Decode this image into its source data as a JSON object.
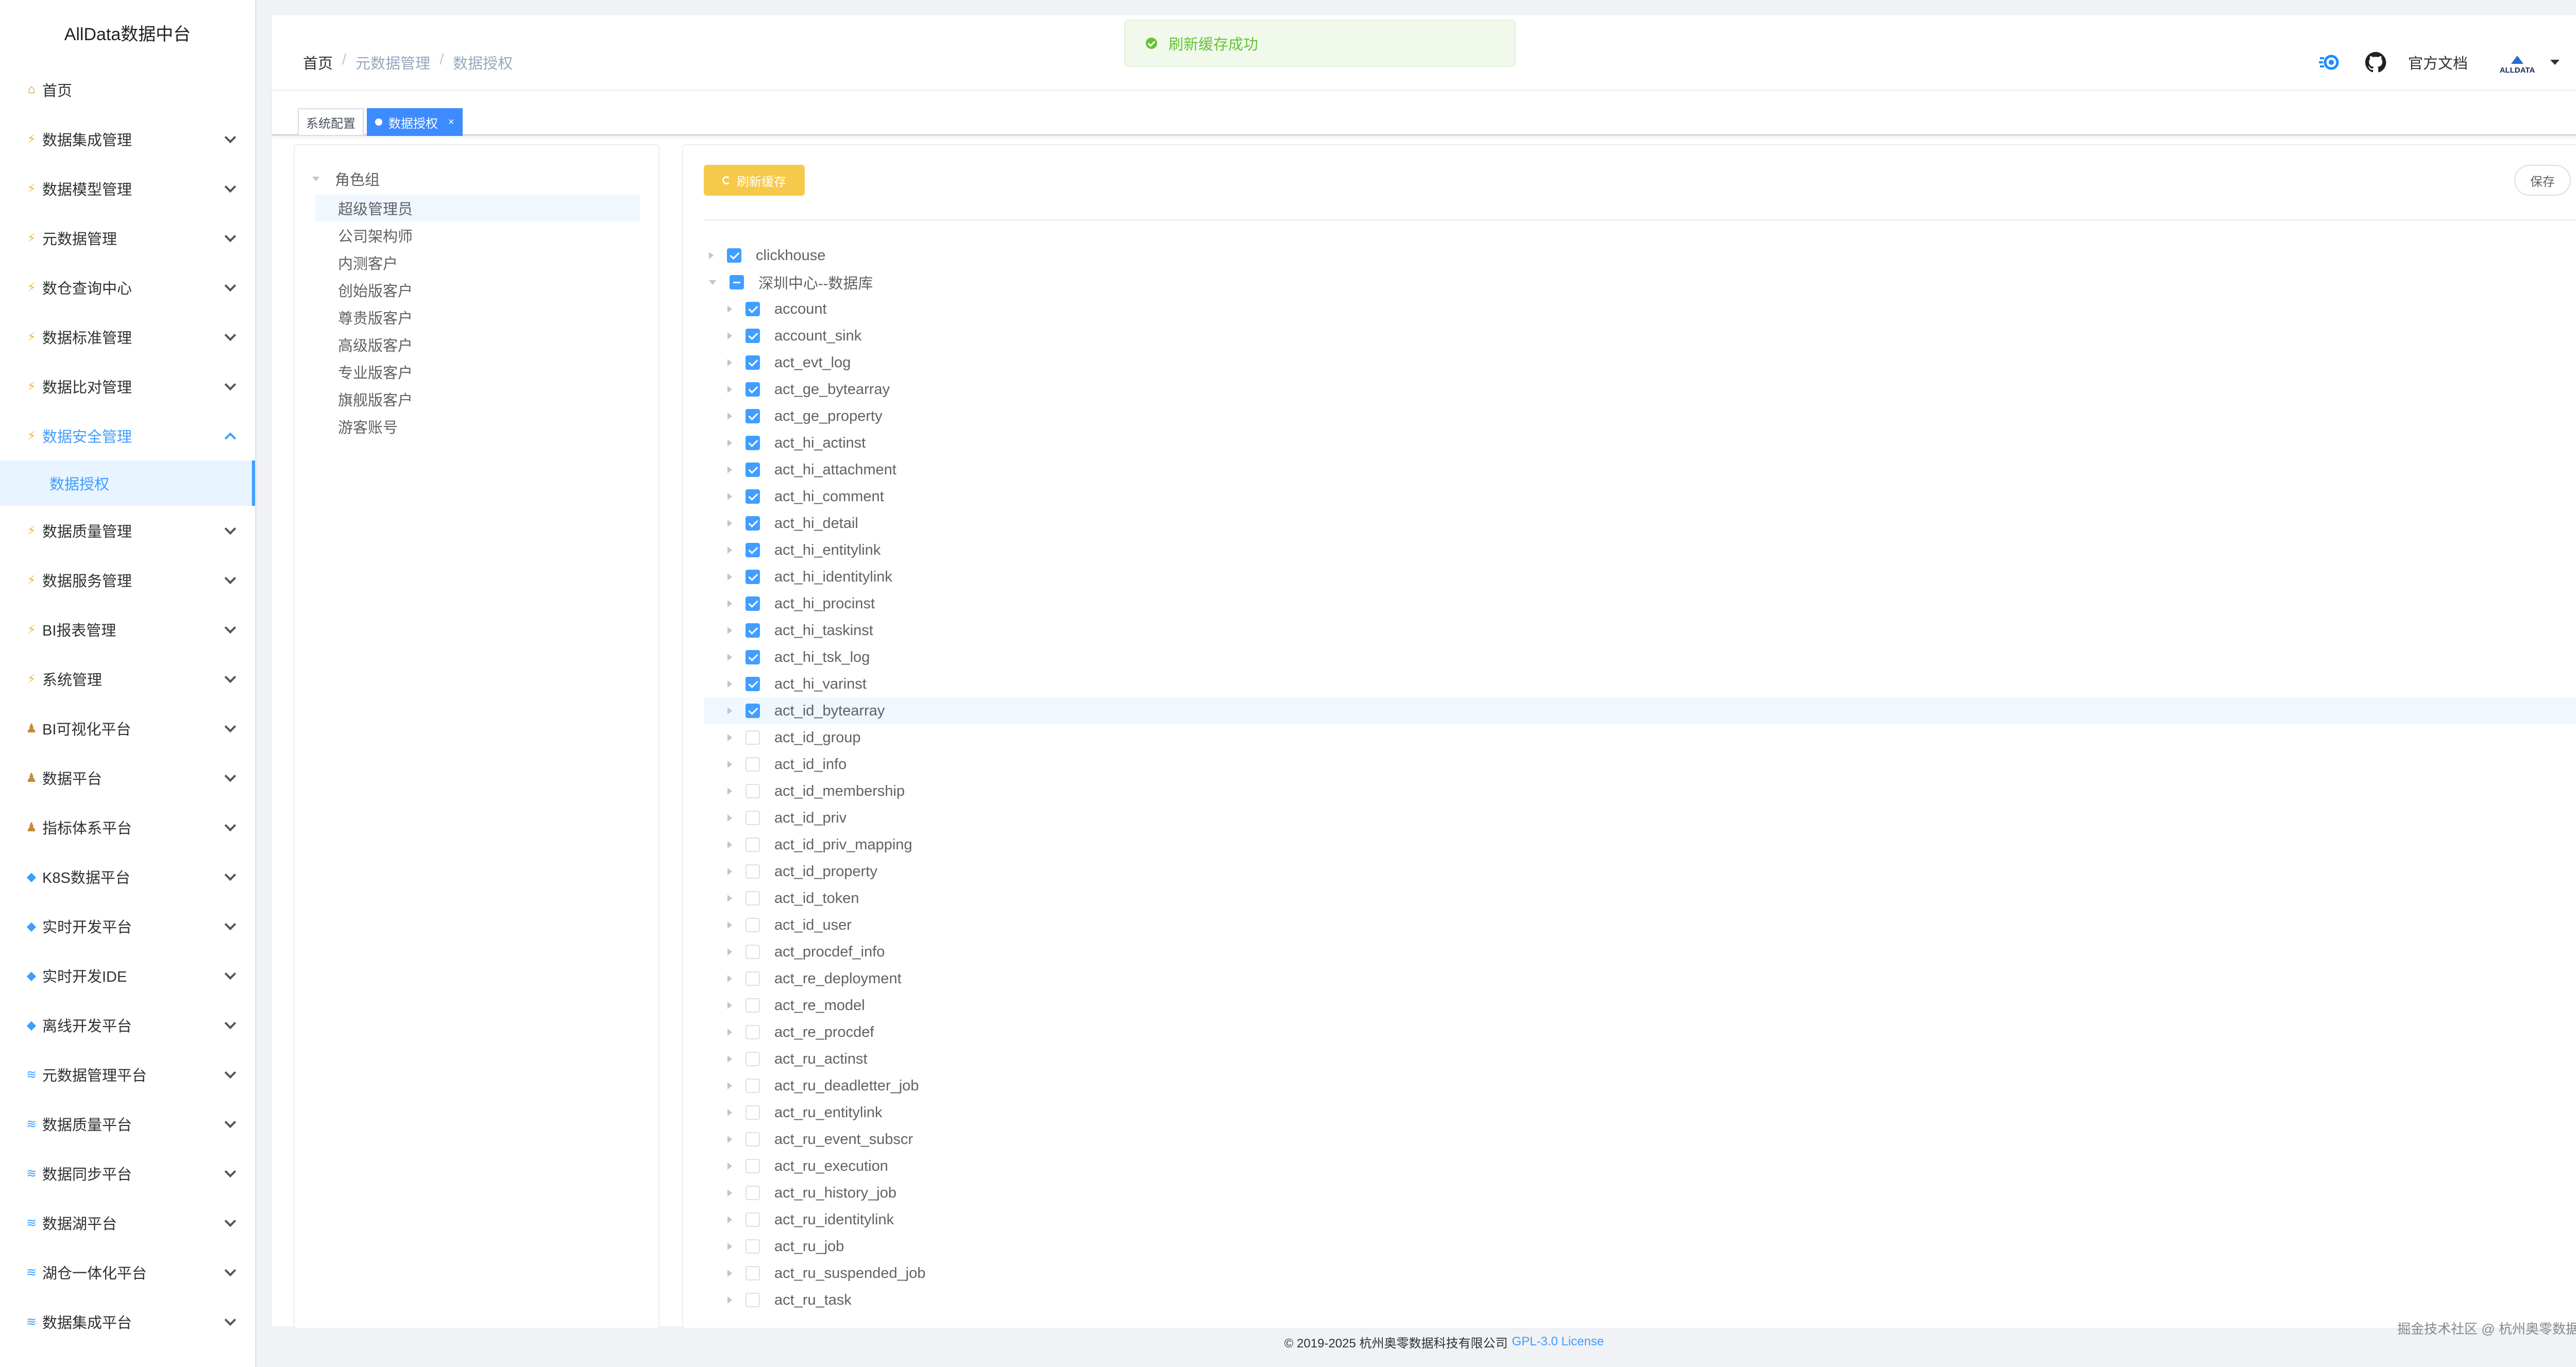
{
  "brand": "AllData数据中台",
  "menu": [
    {
      "label": "首页",
      "icon": "home"
    },
    {
      "label": "数据集成管理",
      "icon": "bolt"
    },
    {
      "label": "数据模型管理",
      "icon": "bolt"
    },
    {
      "label": "元数据管理",
      "icon": "bolt"
    },
    {
      "label": "数仓查询中心",
      "icon": "bolt"
    },
    {
      "label": "数据标准管理",
      "icon": "bolt"
    },
    {
      "label": "数据比对管理",
      "icon": "bolt"
    },
    {
      "label": "数据安全管理",
      "icon": "bolt"
    },
    {
      "label": "数据质量管理",
      "icon": "bolt"
    },
    {
      "label": "数据服务管理",
      "icon": "bolt"
    },
    {
      "label": "BI报表管理",
      "icon": "bolt"
    },
    {
      "label": "系统管理",
      "icon": "bolt"
    },
    {
      "label": "BI可视化平台",
      "icon": "person"
    },
    {
      "label": "数据平台",
      "icon": "person"
    },
    {
      "label": "指标体系平台",
      "icon": "person"
    },
    {
      "label": "K8S数据平台",
      "icon": "gem"
    },
    {
      "label": "实时开发平台",
      "icon": "gem"
    },
    {
      "label": "实时开发IDE",
      "icon": "gem"
    },
    {
      "label": "离线开发平台",
      "icon": "gem"
    },
    {
      "label": "元数据管理平台",
      "icon": "db"
    },
    {
      "label": "数据质量平台",
      "icon": "db"
    },
    {
      "label": "数据同步平台",
      "icon": "db"
    },
    {
      "label": "数据湖平台",
      "icon": "db"
    },
    {
      "label": "湖仓一体化平台",
      "icon": "db"
    },
    {
      "label": "数据集成平台",
      "icon": "db"
    }
  ],
  "submenu_active": "数据授权",
  "breadcrumb": {
    "home": "首页",
    "parent": "元数据管理",
    "current": "数据授权",
    "sep": "/"
  },
  "toast": "刷新缓存成功",
  "nav": {
    "docs": "官方文档",
    "avatar_text": "ALLDATA"
  },
  "tags": {
    "system": "系统配置",
    "active": "数据授权",
    "close": "×"
  },
  "roles": {
    "root": "角色组",
    "items": [
      "超级管理员",
      "公司架构师",
      "内测客户",
      "创始版客户",
      "尊贵版客户",
      "高级版客户",
      "专业版客户",
      "旗舰版客户",
      "游客账号"
    ]
  },
  "buttons": {
    "refresh": "刷新缓存",
    "save": "保存"
  },
  "tree": {
    "sources": [
      {
        "label": "clickhouse",
        "state": "checked"
      },
      {
        "label": "深圳中心--数据库",
        "state": "indeterminate"
      }
    ],
    "tables": [
      {
        "label": "account",
        "checked": true
      },
      {
        "label": "account_sink",
        "checked": true
      },
      {
        "label": "act_evt_log",
        "checked": true
      },
      {
        "label": "act_ge_bytearray",
        "checked": true
      },
      {
        "label": "act_ge_property",
        "checked": true
      },
      {
        "label": "act_hi_actinst",
        "checked": true
      },
      {
        "label": "act_hi_attachment",
        "checked": true
      },
      {
        "label": "act_hi_comment",
        "checked": true
      },
      {
        "label": "act_hi_detail",
        "checked": true
      },
      {
        "label": "act_hi_entitylink",
        "checked": true
      },
      {
        "label": "act_hi_identitylink",
        "checked": true
      },
      {
        "label": "act_hi_procinst",
        "checked": true
      },
      {
        "label": "act_hi_taskinst",
        "checked": true
      },
      {
        "label": "act_hi_tsk_log",
        "checked": true
      },
      {
        "label": "act_hi_varinst",
        "checked": true
      },
      {
        "label": "act_id_bytearray",
        "checked": true
      },
      {
        "label": "act_id_group",
        "checked": false
      },
      {
        "label": "act_id_info",
        "checked": false
      },
      {
        "label": "act_id_membership",
        "checked": false
      },
      {
        "label": "act_id_priv",
        "checked": false
      },
      {
        "label": "act_id_priv_mapping",
        "checked": false
      },
      {
        "label": "act_id_property",
        "checked": false
      },
      {
        "label": "act_id_token",
        "checked": false
      },
      {
        "label": "act_id_user",
        "checked": false
      },
      {
        "label": "act_procdef_info",
        "checked": false
      },
      {
        "label": "act_re_deployment",
        "checked": false
      },
      {
        "label": "act_re_model",
        "checked": false
      },
      {
        "label": "act_re_procdef",
        "checked": false
      },
      {
        "label": "act_ru_actinst",
        "checked": false
      },
      {
        "label": "act_ru_deadletter_job",
        "checked": false
      },
      {
        "label": "act_ru_entitylink",
        "checked": false
      },
      {
        "label": "act_ru_event_subscr",
        "checked": false
      },
      {
        "label": "act_ru_execution",
        "checked": false
      },
      {
        "label": "act_ru_history_job",
        "checked": false
      },
      {
        "label": "act_ru_identitylink",
        "checked": false
      },
      {
        "label": "act_ru_job",
        "checked": false
      },
      {
        "label": "act_ru_suspended_job",
        "checked": false
      },
      {
        "label": "act_ru_task",
        "checked": false
      }
    ]
  },
  "footer": {
    "copyright": "© 2019-2025 杭州奥零数据科技有限公司",
    "license": "GPL-3.0 License"
  },
  "watermark": "掘金技术社区 @ 杭州奥零数据科技",
  "colors": {
    "primary": "#409eff",
    "success": "#67c23a",
    "warning_btn": "#f5c94a"
  }
}
